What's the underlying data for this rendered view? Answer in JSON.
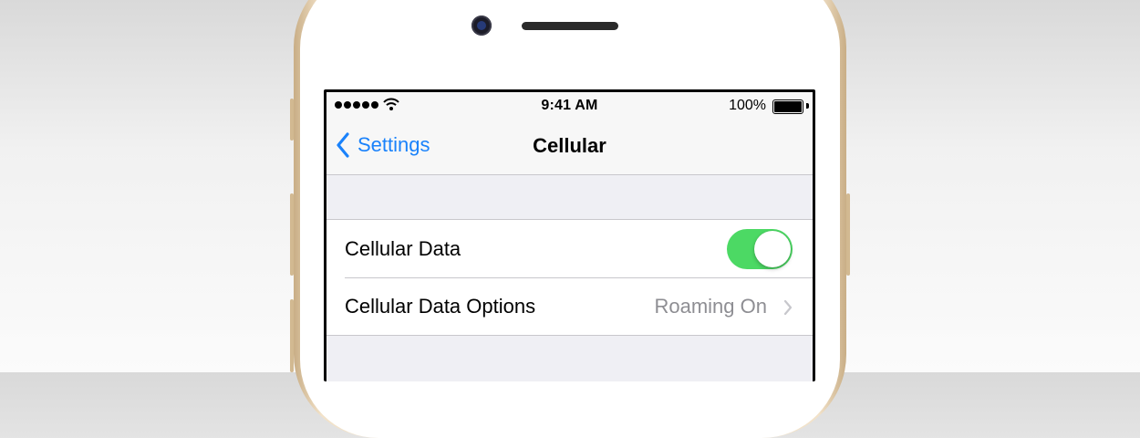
{
  "status_bar": {
    "time": "9:41 AM",
    "battery_percent": "100%",
    "signal_strength": 5,
    "icons": [
      "signal-dots-icon",
      "wifi-icon",
      "battery-icon"
    ]
  },
  "nav": {
    "back_label": "Settings",
    "title": "Cellular",
    "icons": [
      "chevron-left-icon"
    ]
  },
  "rows": [
    {
      "label": "Cellular Data",
      "toggle_on": true
    },
    {
      "label": "Cellular Data Options",
      "value": "Roaming On",
      "icon": "chevron-right-icon"
    }
  ],
  "colors": {
    "accent": "#1a82fb",
    "toggle_on": "#4cd964",
    "secondary_text": "#8e8e93",
    "group_background": "#efeff4"
  }
}
